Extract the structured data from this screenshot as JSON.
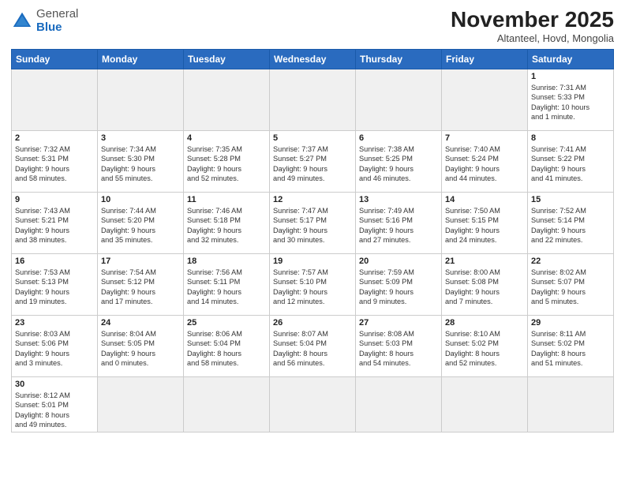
{
  "logo": {
    "general": "General",
    "blue": "Blue"
  },
  "title": "November 2025",
  "subtitle": "Altanteel, Hovd, Mongolia",
  "weekdays": [
    "Sunday",
    "Monday",
    "Tuesday",
    "Wednesday",
    "Thursday",
    "Friday",
    "Saturday"
  ],
  "weeks": [
    [
      {
        "day": "",
        "info": ""
      },
      {
        "day": "",
        "info": ""
      },
      {
        "day": "",
        "info": ""
      },
      {
        "day": "",
        "info": ""
      },
      {
        "day": "",
        "info": ""
      },
      {
        "day": "",
        "info": ""
      },
      {
        "day": "1",
        "info": "Sunrise: 7:31 AM\nSunset: 5:33 PM\nDaylight: 10 hours\nand 1 minute."
      }
    ],
    [
      {
        "day": "2",
        "info": "Sunrise: 7:32 AM\nSunset: 5:31 PM\nDaylight: 9 hours\nand 58 minutes."
      },
      {
        "day": "3",
        "info": "Sunrise: 7:34 AM\nSunset: 5:30 PM\nDaylight: 9 hours\nand 55 minutes."
      },
      {
        "day": "4",
        "info": "Sunrise: 7:35 AM\nSunset: 5:28 PM\nDaylight: 9 hours\nand 52 minutes."
      },
      {
        "day": "5",
        "info": "Sunrise: 7:37 AM\nSunset: 5:27 PM\nDaylight: 9 hours\nand 49 minutes."
      },
      {
        "day": "6",
        "info": "Sunrise: 7:38 AM\nSunset: 5:25 PM\nDaylight: 9 hours\nand 46 minutes."
      },
      {
        "day": "7",
        "info": "Sunrise: 7:40 AM\nSunset: 5:24 PM\nDaylight: 9 hours\nand 44 minutes."
      },
      {
        "day": "8",
        "info": "Sunrise: 7:41 AM\nSunset: 5:22 PM\nDaylight: 9 hours\nand 41 minutes."
      }
    ],
    [
      {
        "day": "9",
        "info": "Sunrise: 7:43 AM\nSunset: 5:21 PM\nDaylight: 9 hours\nand 38 minutes."
      },
      {
        "day": "10",
        "info": "Sunrise: 7:44 AM\nSunset: 5:20 PM\nDaylight: 9 hours\nand 35 minutes."
      },
      {
        "day": "11",
        "info": "Sunrise: 7:46 AM\nSunset: 5:18 PM\nDaylight: 9 hours\nand 32 minutes."
      },
      {
        "day": "12",
        "info": "Sunrise: 7:47 AM\nSunset: 5:17 PM\nDaylight: 9 hours\nand 30 minutes."
      },
      {
        "day": "13",
        "info": "Sunrise: 7:49 AM\nSunset: 5:16 PM\nDaylight: 9 hours\nand 27 minutes."
      },
      {
        "day": "14",
        "info": "Sunrise: 7:50 AM\nSunset: 5:15 PM\nDaylight: 9 hours\nand 24 minutes."
      },
      {
        "day": "15",
        "info": "Sunrise: 7:52 AM\nSunset: 5:14 PM\nDaylight: 9 hours\nand 22 minutes."
      }
    ],
    [
      {
        "day": "16",
        "info": "Sunrise: 7:53 AM\nSunset: 5:13 PM\nDaylight: 9 hours\nand 19 minutes."
      },
      {
        "day": "17",
        "info": "Sunrise: 7:54 AM\nSunset: 5:12 PM\nDaylight: 9 hours\nand 17 minutes."
      },
      {
        "day": "18",
        "info": "Sunrise: 7:56 AM\nSunset: 5:11 PM\nDaylight: 9 hours\nand 14 minutes."
      },
      {
        "day": "19",
        "info": "Sunrise: 7:57 AM\nSunset: 5:10 PM\nDaylight: 9 hours\nand 12 minutes."
      },
      {
        "day": "20",
        "info": "Sunrise: 7:59 AM\nSunset: 5:09 PM\nDaylight: 9 hours\nand 9 minutes."
      },
      {
        "day": "21",
        "info": "Sunrise: 8:00 AM\nSunset: 5:08 PM\nDaylight: 9 hours\nand 7 minutes."
      },
      {
        "day": "22",
        "info": "Sunrise: 8:02 AM\nSunset: 5:07 PM\nDaylight: 9 hours\nand 5 minutes."
      }
    ],
    [
      {
        "day": "23",
        "info": "Sunrise: 8:03 AM\nSunset: 5:06 PM\nDaylight: 9 hours\nand 3 minutes."
      },
      {
        "day": "24",
        "info": "Sunrise: 8:04 AM\nSunset: 5:05 PM\nDaylight: 9 hours\nand 0 minutes."
      },
      {
        "day": "25",
        "info": "Sunrise: 8:06 AM\nSunset: 5:04 PM\nDaylight: 8 hours\nand 58 minutes."
      },
      {
        "day": "26",
        "info": "Sunrise: 8:07 AM\nSunset: 5:04 PM\nDaylight: 8 hours\nand 56 minutes."
      },
      {
        "day": "27",
        "info": "Sunrise: 8:08 AM\nSunset: 5:03 PM\nDaylight: 8 hours\nand 54 minutes."
      },
      {
        "day": "28",
        "info": "Sunrise: 8:10 AM\nSunset: 5:02 PM\nDaylight: 8 hours\nand 52 minutes."
      },
      {
        "day": "29",
        "info": "Sunrise: 8:11 AM\nSunset: 5:02 PM\nDaylight: 8 hours\nand 51 minutes."
      }
    ],
    [
      {
        "day": "30",
        "info": "Sunrise: 8:12 AM\nSunset: 5:01 PM\nDaylight: 8 hours\nand 49 minutes."
      },
      {
        "day": "",
        "info": ""
      },
      {
        "day": "",
        "info": ""
      },
      {
        "day": "",
        "info": ""
      },
      {
        "day": "",
        "info": ""
      },
      {
        "day": "",
        "info": ""
      },
      {
        "day": "",
        "info": ""
      }
    ]
  ]
}
